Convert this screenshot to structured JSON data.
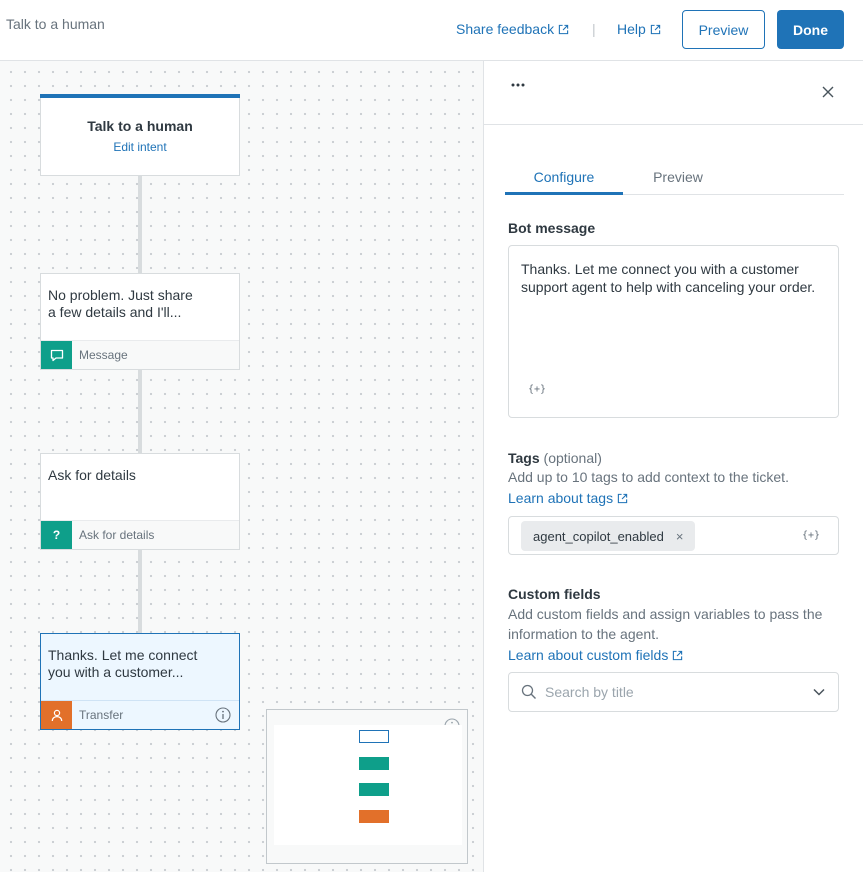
{
  "header": {
    "title": "Talk to a human",
    "share_feedback": "Share feedback",
    "help": "Help",
    "separator": "|",
    "preview_label": "Preview",
    "done_label": "Done"
  },
  "canvas": {
    "start_node": {
      "title": "Talk to a human",
      "link": "Edit intent"
    },
    "steps": [
      {
        "body_line1": "No problem. Just share",
        "body_line2": "a few details and I'll...",
        "type_label": "Message",
        "icon": "message-icon",
        "color": "#0e9f8a"
      },
      {
        "body_line1": "Ask for details",
        "body_line2": "",
        "type_label": "Ask for details",
        "icon": "question-icon",
        "glyph": "?",
        "color": "#0e9f8a"
      },
      {
        "body_line1": "Thanks. Let me connect",
        "body_line2": "you with a customer...",
        "type_label": "Transfer",
        "icon": "person-icon",
        "color": "#e2702a"
      }
    ]
  },
  "minimap": {
    "colors": {
      "start": "#ffffff",
      "message": "#0e9f8a",
      "ask": "#0e9f8a",
      "transfer": "#e2702a"
    }
  },
  "panel": {
    "more_icon": "more-horizontal-icon",
    "tabs": [
      {
        "label": "Configure",
        "active": true
      },
      {
        "label": "Preview",
        "active": false
      }
    ],
    "bot_message": {
      "label": "Bot message",
      "text": "Thanks. Let me connect you with a customer support agent to help with canceling your order.",
      "variable_token": "{+}"
    },
    "tags": {
      "label": "Tags",
      "optional": "(optional)",
      "hint": "Add up to 10 tags to add context to the ticket.",
      "learn_link": "Learn about tags",
      "items": [
        "agent_copilot_enabled"
      ],
      "remove_glyph": "×",
      "variable_token": "{+}"
    },
    "custom_fields": {
      "label": "Custom fields",
      "hint": "Add custom fields and assign variables to pass the information to the agent.",
      "learn_link": "Learn about custom fields",
      "search_placeholder": "Search by title"
    }
  },
  "colors": {
    "accent": "#1f73b7",
    "text": "#2f3941",
    "muted": "#68737d"
  }
}
